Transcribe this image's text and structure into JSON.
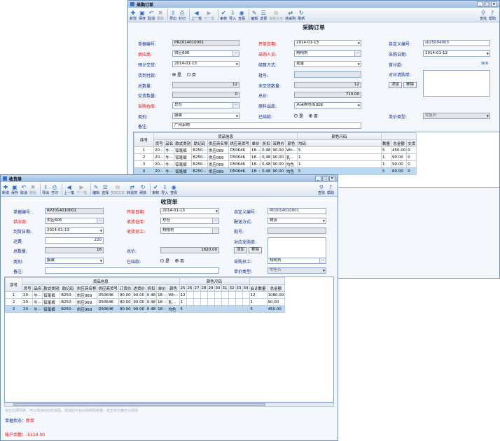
{
  "po": {
    "title": "采购订单",
    "tb": [
      "新增",
      "保存",
      "取消",
      "删除",
      "导出",
      "打印",
      "上一笔",
      "下一笔",
      "审核",
      "导入",
      "查看",
      "编辑",
      "选择",
      "复制文本",
      "转采购",
      "刷新",
      "查找",
      "帮助"
    ],
    "form_title": "采购订单",
    "f": {
      "no_l": "单据编号:",
      "no": "PR2014010001",
      "date_l": "开单日期:",
      "date": "2014-01-13",
      "custom_l": "自定义编号:",
      "custom": "sk25004003",
      "sup_l": "供应商:",
      "sup": "供应606",
      "buyer_l": "采购人员:",
      "buyer": "翔翔刘",
      "buydate_l": "采购日期:",
      "buydate": "2014-01-13",
      "due_l": "预计交货:",
      "due": "2014-01-13",
      "pay_l": "结算方式:",
      "pay": "现金",
      "first_l": "首付款:",
      "first": "300",
      "goods_l": "货到付款:",
      "yes": "是",
      "no2": "否",
      "batch_l": "批号:",
      "ref_l": "对应请购单:",
      "qty_l": "总数量:",
      "qty": "12",
      "undel_l": "未交货数量:",
      "undel": "12",
      "delq_l": "交货数量:",
      "delq": "0",
      "total_l": "总价:",
      "total": "710.00",
      "add": "添加",
      "remove": "移除",
      "wh_l": "采购仓库:",
      "wh": "总仓",
      "src_l": "原料出库:",
      "src": "从采购仓库出库",
      "cat_l": "类别:",
      "cat": "服装",
      "end_l": "已结款:",
      "price_l": "单价类型:",
      "price": "零售价",
      "memo_l": "备注:",
      "memo": "广州采购"
    },
    "grp_goods": "货品信息",
    "grp_color": "颜色尺码",
    "cols": [
      "序号",
      "货号",
      "品名",
      "款式类别",
      "助记码",
      "供应商名称",
      "供应商货号",
      "单价",
      "折扣",
      "采购价",
      "颜色",
      "均码",
      "数量",
      "总金额",
      "交货"
    ],
    "rows": [
      [
        "1",
        "20···",
        "牛···",
        "铅笔裤",
        "B250···",
        "供应069",
        "D50646",
        "18···",
        "0.48",
        "90.00",
        "Wh···",
        "5",
        "5",
        "450.00",
        "0"
      ],
      [
        "2",
        "20···",
        "牛···",
        "铅笔裤",
        "B250···",
        "供应069",
        "D50646",
        "18···",
        "0.48",
        "90.00",
        "乳···",
        "1",
        "1",
        "90.00",
        "0"
      ],
      [
        "3",
        "20···",
        "牛···",
        "铅笔裤",
        "B250···",
        "供应069",
        "D50646",
        "18···",
        "0.48",
        "90.00",
        "均色",
        "1",
        "1",
        "90.00",
        "0"
      ],
      [
        "4",
        "20···",
        "牛···",
        "铅笔裤",
        "B250···",
        "供应069",
        "D50646",
        "18···",
        "0.48",
        "90.00",
        "均色",
        "5",
        "5",
        "80.00",
        "0"
      ]
    ]
  },
  "recv": {
    "title": "收货单",
    "tb": [
      "新增",
      "保存",
      "取消",
      "删除",
      "导出",
      "打印",
      "上一笔",
      "下一笔",
      "编辑",
      "选择",
      "复制文本",
      "转退货",
      "刷新",
      "审核",
      "导入",
      "查看",
      "查找",
      "帮助"
    ],
    "form_title": "收货单",
    "f": {
      "no_l": "单据编号:",
      "no": "RP2014010001",
      "date_l": "开单日期:",
      "date": "2014-01-13",
      "custom_l": "自定义编号:",
      "custom": "RP2014010001",
      "sup_l": "供应商:",
      "sup": "供应606",
      "wh_l": "收货仓库:",
      "wh": "总仓",
      "ship_l": "配送方式:",
      "ship": "物流",
      "arr_l": "到货日期:",
      "arr": "2014-01-13",
      "staff_l": "收货员工:",
      "staff": "翔翔刘",
      "batch_l": "批号:",
      "freight_l": "运费:",
      "freight": "220",
      "ref_l": "对应采购单:",
      "qty_l": "总数量:",
      "qty": "18",
      "total_l": "总价:",
      "total": "1620.00",
      "add": "添加",
      "remove": "移除",
      "cat_l": "类别:",
      "cat": "服装",
      "end_l": "已结款:",
      "yes": "是",
      "no2": "否",
      "buyer_l": "采购员工:",
      "buyer": "翔翔刘",
      "memo_l": "备注:",
      "price_l": "单价类型:",
      "price": "零售价"
    },
    "grp_goods": "货品信息",
    "grp_color": "颜色尺码",
    "cols": [
      "序号",
      "货号",
      "品名",
      "款式类别",
      "助记码",
      "供应商名称",
      "供应商货号",
      "订货价",
      "进货价",
      "折扣",
      "单价",
      "颜色",
      "25",
      "26",
      "27",
      "28",
      "29",
      "30",
      "31",
      "32",
      "33",
      "34",
      "会计数量",
      "总金额"
    ],
    "rows": [
      [
        "1",
        "20···",
        "牛···",
        "铅笔裤",
        "B250···",
        "供应069",
        "D50646",
        "90.00",
        "90.00",
        "0.48",
        "18···",
        "Wh···",
        "12",
        "",
        "",
        "",
        "",
        "",
        "",
        "",
        "",
        "",
        "12",
        "1080.00"
      ],
      [
        "2",
        "20···",
        "牛···",
        "铅笔裤",
        "B250···",
        "供应069",
        "D50646",
        "90.00",
        "90.00",
        "0.48",
        "18···",
        "乳···",
        "1",
        "",
        "",
        "",
        "",
        "",
        "",
        "",
        "",
        "",
        "1",
        "90.00"
      ],
      [
        "3",
        "20···",
        "牛···",
        "铅笔裤",
        "B250···",
        "供应069",
        "D50646",
        "90.00",
        "90.00",
        "0.48",
        "18···",
        "均色",
        "5",
        "",
        "",
        "",
        "",
        "",
        "",
        "",
        "",
        "",
        "5",
        "450.00"
      ]
    ],
    "hint": "双击左侧列表，可以增加对应的货品，增加后可在右侧修改数量，双击单元格可以修改",
    "status_l": "单据状态：",
    "status": "新单",
    "acct_l": "账户余额：",
    "acct": "-5110.00"
  }
}
